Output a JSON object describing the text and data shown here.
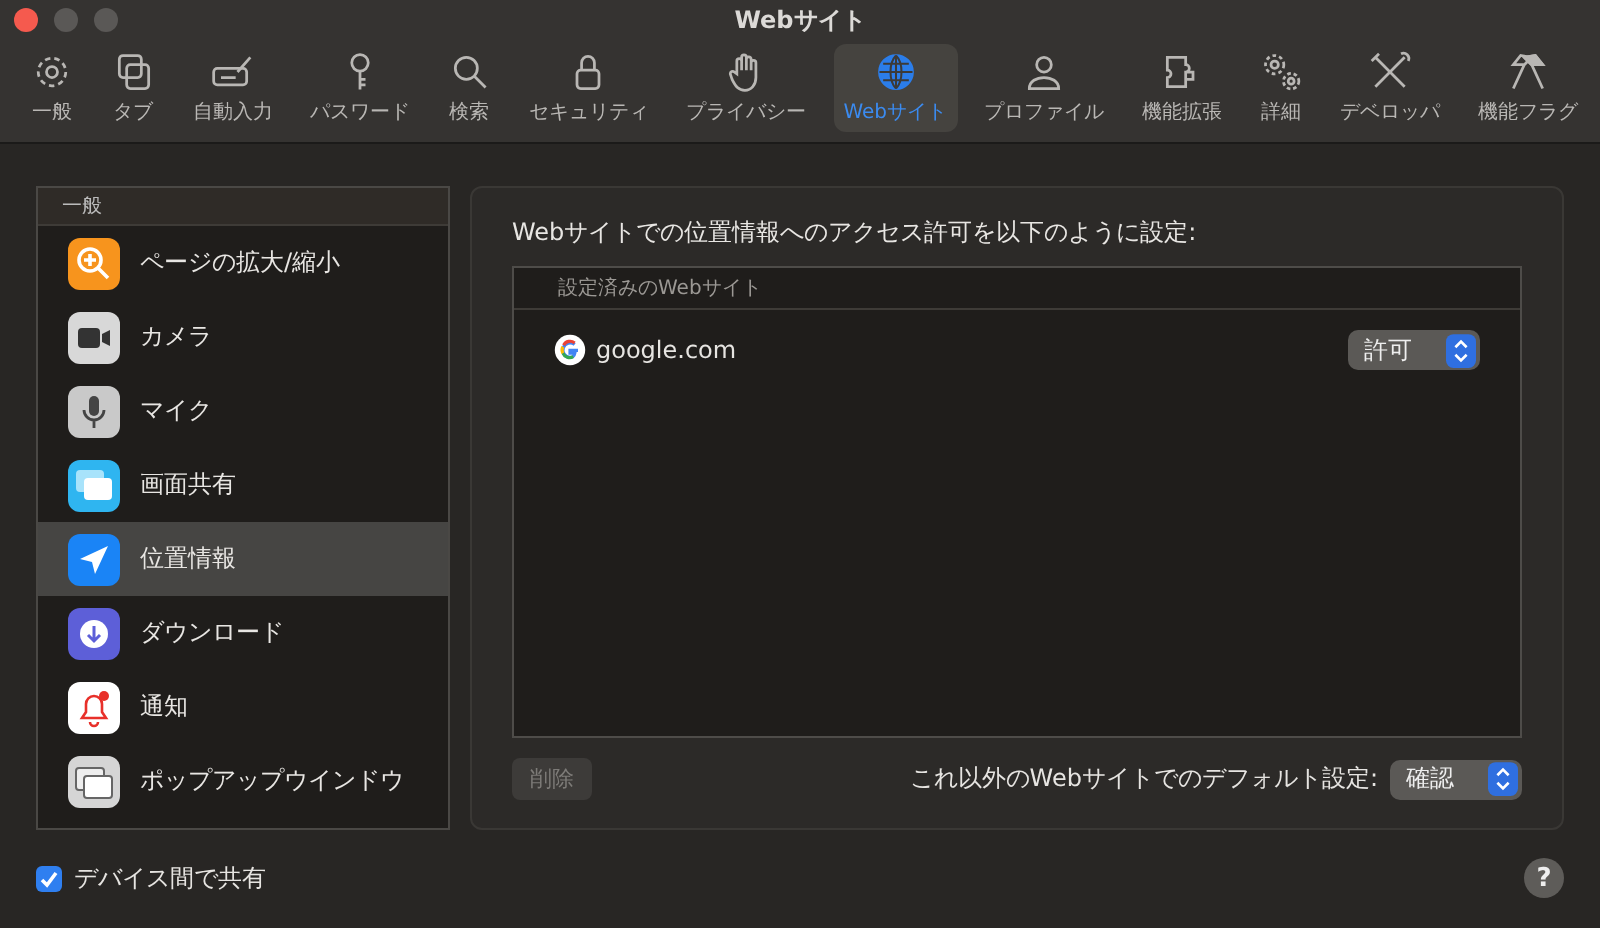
{
  "window": {
    "title": "Webサイト"
  },
  "toolbar": [
    {
      "label": "一般",
      "selected": false
    },
    {
      "label": "タブ",
      "selected": false
    },
    {
      "label": "自動入力",
      "selected": false
    },
    {
      "label": "パスワード",
      "selected": false
    },
    {
      "label": "検索",
      "selected": false
    },
    {
      "label": "セキュリティ",
      "selected": false
    },
    {
      "label": "プライバシー",
      "selected": false
    },
    {
      "label": "Webサイト",
      "selected": true
    },
    {
      "label": "プロファイル",
      "selected": false
    },
    {
      "label": "機能拡張",
      "selected": false
    },
    {
      "label": "詳細",
      "selected": false
    },
    {
      "label": "デベロッパ",
      "selected": false
    },
    {
      "label": "機能フラグ",
      "selected": false
    }
  ],
  "sidebar": {
    "header": "一般",
    "items": [
      {
        "label": "ページの拡大/縮小",
        "selected": false
      },
      {
        "label": "カメラ",
        "selected": false
      },
      {
        "label": "マイク",
        "selected": false
      },
      {
        "label": "画面共有",
        "selected": false
      },
      {
        "label": "位置情報",
        "selected": true
      },
      {
        "label": "ダウンロード",
        "selected": false
      },
      {
        "label": "通知",
        "selected": false
      },
      {
        "label": "ポップアップウインドウ",
        "selected": false
      }
    ]
  },
  "panel": {
    "heading": "Webサイトでの位置情報へのアクセス許可を以下のように設定:",
    "table": {
      "column": "設定済みのWebサイト",
      "rows": [
        {
          "site": "google.com",
          "setting": "許可"
        }
      ]
    },
    "remove_button": {
      "label": "削除",
      "disabled": true
    },
    "default_label": "これ以外のWebサイトでのデフォルト設定:",
    "default_value": "確認"
  },
  "share_checkbox": {
    "label": "デバイス間で共有",
    "checked": true
  },
  "help_button": "?"
}
